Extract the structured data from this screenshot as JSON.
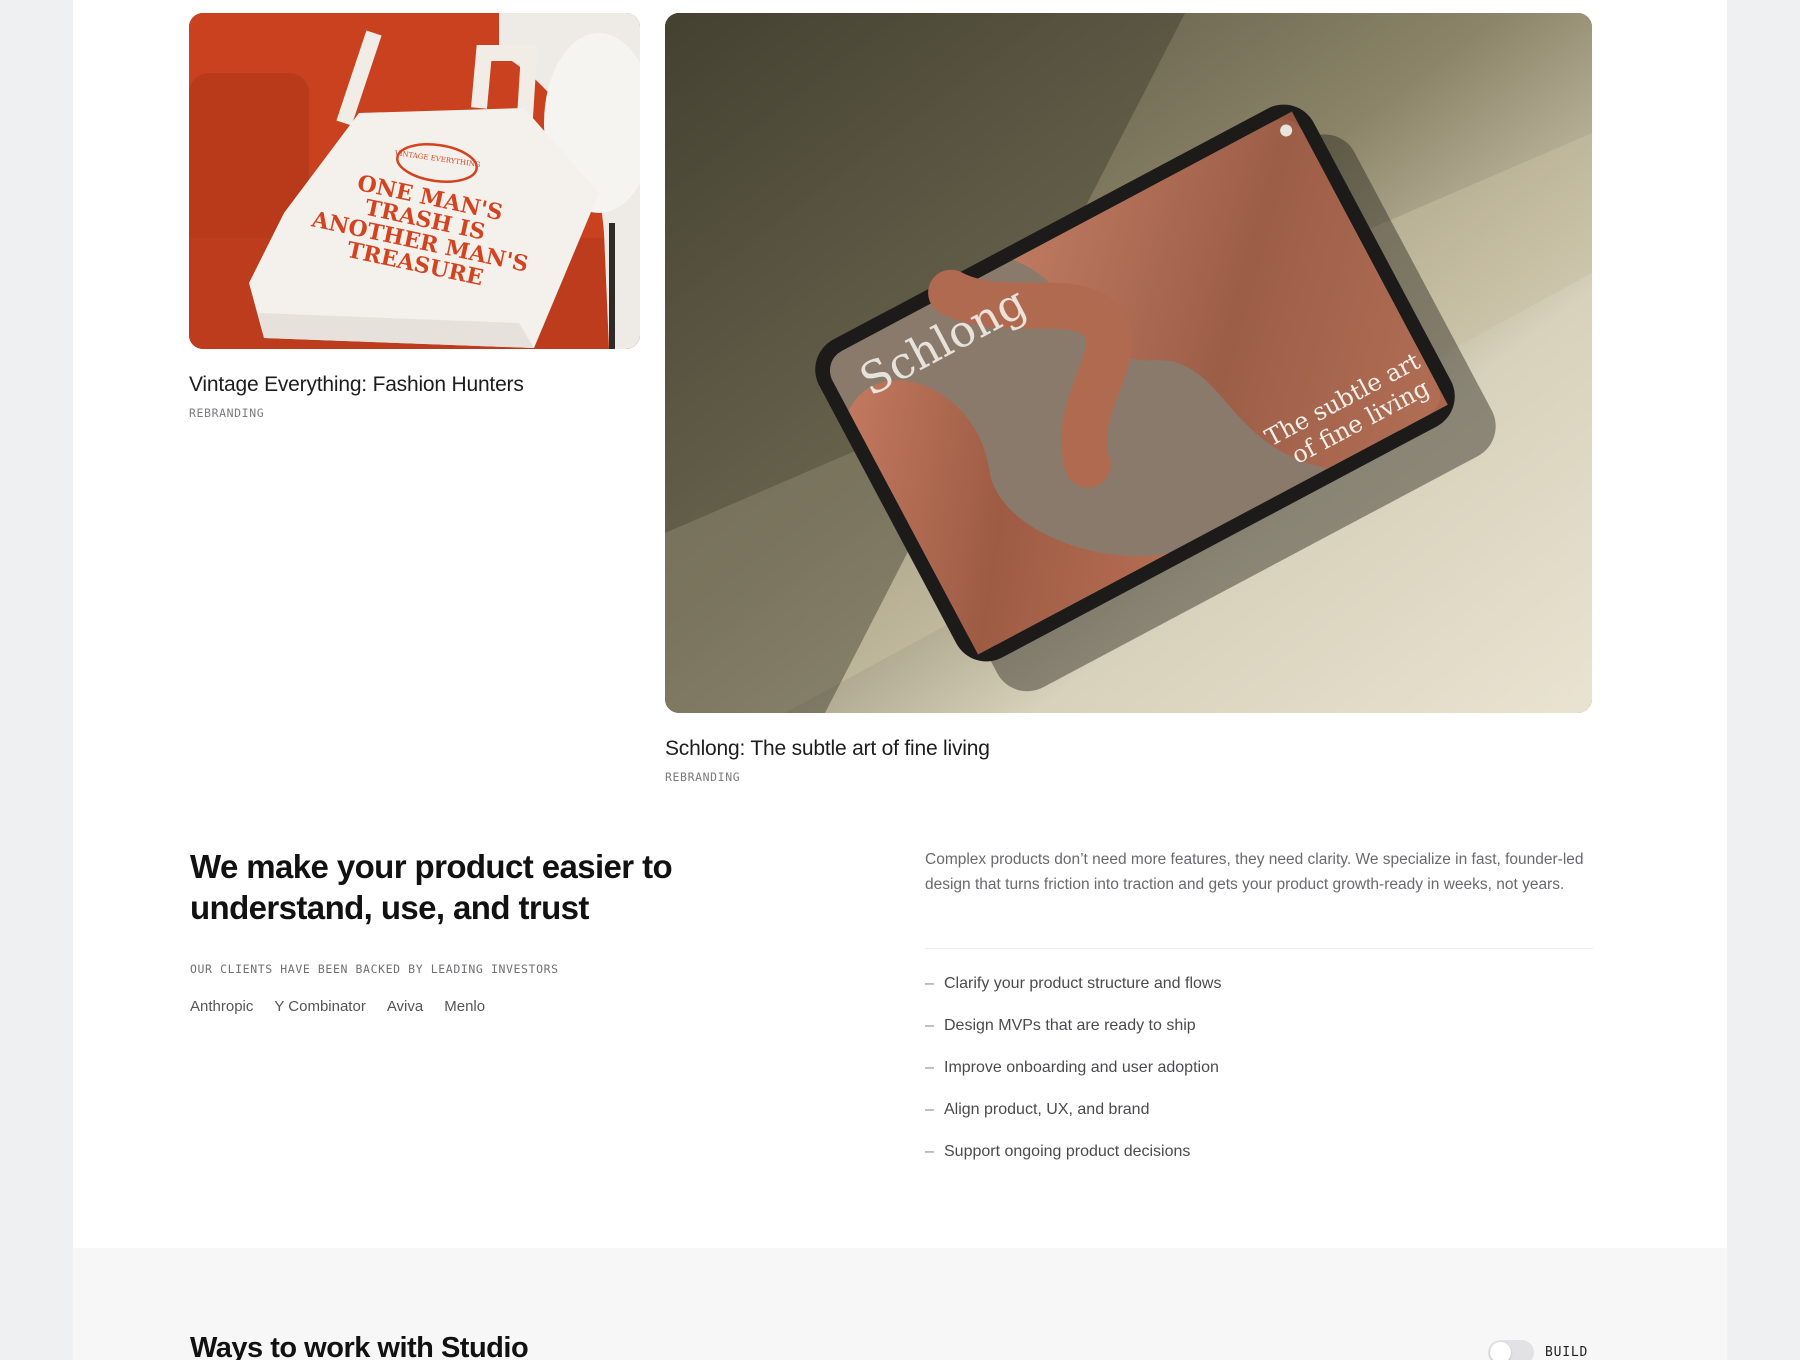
{
  "projects": [
    {
      "title": "Vintage Everything: Fashion Hunters",
      "tag": "REBRANDING",
      "image": {
        "badge": "VINTAGE EVERYTHING",
        "slogan_lines": [
          "ONE MAN'S",
          "TRASH IS",
          "ANOTHER MAN'S",
          "TREASURE"
        ]
      }
    },
    {
      "title": "Schlong: The subtle art of fine living",
      "tag": "REBRANDING",
      "image": {
        "brand": "Schlong",
        "caption_lines": [
          "The subtle art",
          "of fine living"
        ]
      }
    }
  ],
  "intro": {
    "headline": "We make your product easier to understand, use, and trust",
    "backed_label": "OUR CLIENTS HAVE BEEN BACKED BY LEADING INVESTORS",
    "investors": [
      "Anthropic",
      "Y Combinator",
      "Aviva",
      "Menlo"
    ],
    "description": "Complex products don’t need more features, they need clarity. We specialize in fast, founder-led design that turns friction into traction and gets your product growth-ready in weeks, not years.",
    "services": [
      "Clarify your product structure and flows",
      "Design MVPs that are ready to ship",
      "Improve onboarding and user adoption",
      "Align product, UX, and brand",
      "Support ongoing product decisions"
    ],
    "dash": "–"
  },
  "ways": {
    "title": "Ways to work with Studio",
    "toggle_label": "BUILD"
  },
  "colors": {
    "tote_red": "#d4431f",
    "tablet_clay": "#a8634a"
  }
}
